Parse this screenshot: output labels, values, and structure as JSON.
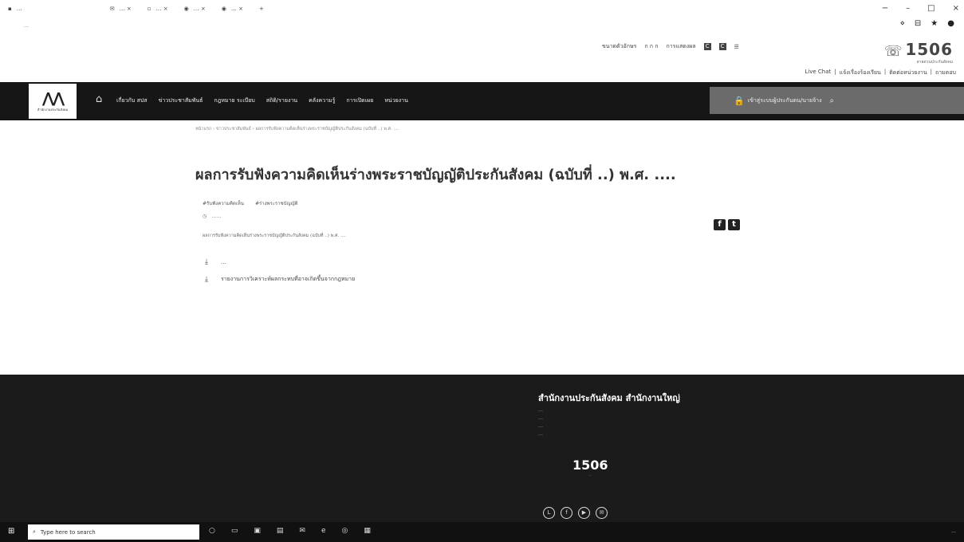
{
  "browser": {
    "tabs": [
      {
        "label": "…",
        "icon": "page-icon"
      },
      {
        "label": "… ×",
        "icon": "mail-icon"
      },
      {
        "label": "… ×",
        "icon": "page-icon"
      },
      {
        "label": "… ×",
        "icon": "chrome-icon"
      },
      {
        "label": "… ×",
        "icon": "chrome-icon"
      }
    ],
    "new_tab": "+",
    "window_controls": [
      "−",
      "–",
      "□",
      "×"
    ],
    "url": "…",
    "url_icons": [
      "⋄",
      "⊟",
      "★",
      "●"
    ]
  },
  "utility_bar": {
    "items": [
      "ขนาดตัวอักษร",
      "ก ก ก",
      "การแสดงผล"
    ],
    "lang": [
      "C",
      "C"
    ]
  },
  "hotline": {
    "number": "1506",
    "sub": "สายด่วนประกันสังคม"
  },
  "top_links": [
    "Live Chat",
    "|",
    "แจ้งเรื่องร้องเรียน",
    "|",
    "ติดต่อหน่วยงาน",
    "|",
    "ถามตอบ"
  ],
  "nav": {
    "logo_text": "สำนักงานประกันสังคม",
    "items": [
      "เกี่ยวกับ สปส",
      "ข่าวประชาสัมพันธ์",
      "กฎหมาย ระเบียบ",
      "สถิติ/รายงาน",
      "คลังความรู้",
      "การเปิดเผย",
      "หน่วยงาน"
    ],
    "search_label": "เข้าสู่ระบบผู้ประกันตน/นายจ้าง"
  },
  "breadcrumb": "หน้าแรก › ข่าวประชาสัมพันธ์ › ผลการรับฟังความคิดเห็นร่างพระราชบัญญัติประกันสังคม (ฉบับที่ ..) พ.ศ. ....",
  "article": {
    "title": "ผลการรับฟังความคิดเห็นร่างพระราชบัญญัติประกันสังคม (ฉบับที่ ..) พ.ศ. ....",
    "tags": [
      "#รับฟังความคิดเห็น",
      "#ร่างพระราชบัญญัติ"
    ],
    "date": "……",
    "description": "ผลการรับฟังความคิดเห็นร่างพระราชบัญญัติประกันสังคม (ฉบับที่ ..) พ.ศ. ....",
    "downloads": [
      "…",
      "รายงานการวิเคราะห์ผลกระทบที่อาจเกิดขึ้นจากกฎหมาย"
    ]
  },
  "share": {
    "facebook": "f",
    "twitter": "t"
  },
  "footer": {
    "title": "สำนักงานประกันสังคม สำนักงานใหญ่",
    "lines": [
      "…",
      "…",
      "…",
      "…"
    ],
    "hotline": "1506",
    "hotline_sub": "…",
    "social": [
      "line-icon",
      "facebook-icon",
      "youtube-icon",
      "email-icon"
    ]
  },
  "taskbar": {
    "search_placeholder": "Type here to search",
    "icons": [
      "cortana-icon",
      "taskview-icon",
      "store-icon",
      "folder-icon",
      "mail-icon",
      "edge-icon",
      "chrome-icon",
      "app-icon"
    ],
    "tray": "…"
  }
}
